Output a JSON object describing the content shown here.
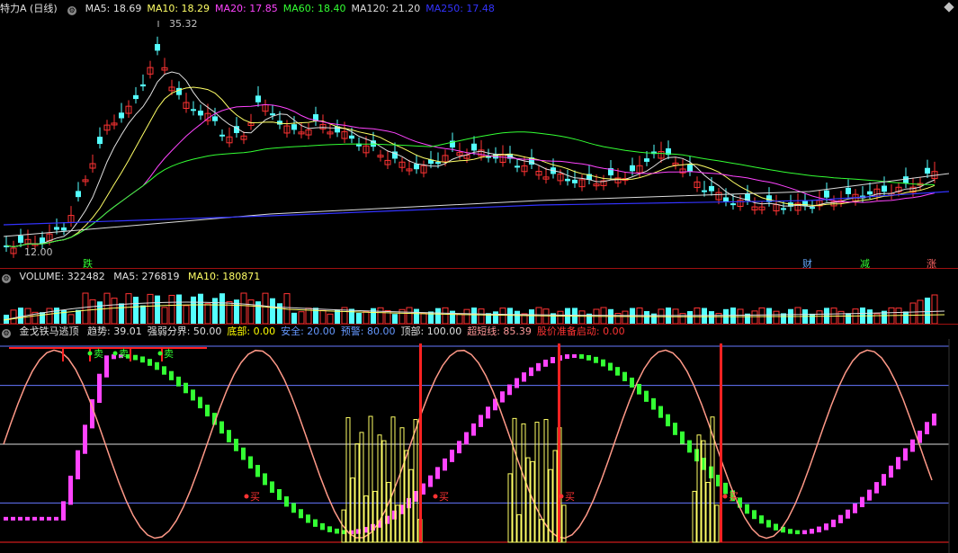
{
  "price_panel": {
    "title": "特力A (日线)",
    "indicators": [
      {
        "label": "MA5: 18.69",
        "color": "#e0e0e0"
      },
      {
        "label": "MA10: 18.29",
        "color": "#ffff66"
      },
      {
        "label": "MA20: 17.85",
        "color": "#ff44ff"
      },
      {
        "label": "MA60: 18.40",
        "color": "#33ff33"
      },
      {
        "label": "MA120: 21.20",
        "color": "#dcdcdc"
      },
      {
        "label": "MA250: 17.48",
        "color": "#3333ff"
      }
    ],
    "high_label": "35.32",
    "low_label": "12.00",
    "event_labels": [
      {
        "text": "跌",
        "color": "#33ff33"
      },
      {
        "text": "财",
        "color": "#66aaff"
      },
      {
        "text": "减",
        "color": "#33ff33"
      },
      {
        "text": "涨",
        "color": "#ff6666"
      }
    ]
  },
  "volume_panel": {
    "title": "VOLUME: 322482",
    "ma5": "MA5: 276819",
    "ma10": "MA10: 180871"
  },
  "indicator_panel": {
    "title": "金戈铁马逃顶",
    "fields": [
      {
        "label": "趋势: 39.01",
        "color": "#e0e0e0"
      },
      {
        "label": "强弱分界: 50.00",
        "color": "#e0e0e0"
      },
      {
        "label": "底部: 0.00",
        "color": "#ffff00"
      },
      {
        "label": "安全: 20.00",
        "color": "#6699ff"
      },
      {
        "label": "预警: 80.00",
        "color": "#6699ff"
      },
      {
        "label": "顶部: 100.00",
        "color": "#e0e0e0"
      },
      {
        "label": "超短线: 85.39",
        "color": "#ff9999"
      },
      {
        "label": "股价准备启动: 0.00",
        "color": "#ff3333"
      }
    ],
    "sell_labels": [
      "卖",
      "卖",
      "卖"
    ],
    "buy_labels": [
      "买",
      "买",
      "买",
      "买"
    ]
  },
  "colors": {
    "up": "#ff3333",
    "down": "#54ffff",
    "grid": "#8b1a1a",
    "ref_line": "#6677ff"
  }
}
